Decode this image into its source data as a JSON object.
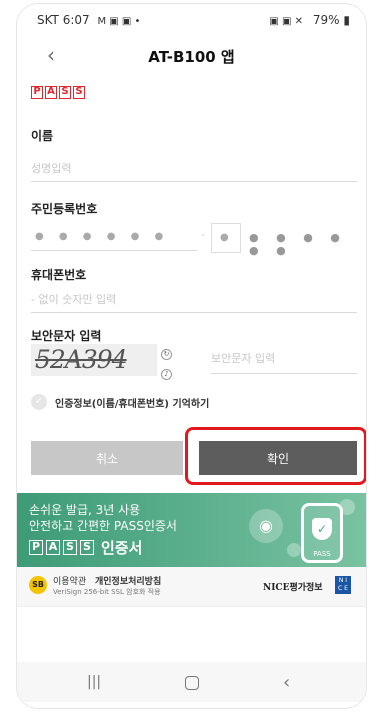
{
  "status_bar": {
    "carrier_time": "SKT 6:07",
    "notif_icons": "M ▣ ▣ •",
    "right_icons": "▣ ▣ ✕",
    "battery": "79%"
  },
  "app_bar": {
    "title": "AT-B100 앱",
    "back_icon": "back-chevron"
  },
  "pass_logo": [
    "P",
    "A",
    "S",
    "S"
  ],
  "form": {
    "name_label": "이름",
    "name_placeholder": "성명입력",
    "rrn_label": "주민등록번호",
    "rrn_front_dots": "● ● ● ● ● ●",
    "rrn_dash": "-",
    "rrn_back_dots": "● ● ● ● ● ●",
    "phone_label": "휴대폰번호",
    "phone_placeholder": "- 없이 숫자만 입력",
    "captcha_label": "보안문자 입력",
    "captcha_text": "52A394",
    "captcha_placeholder": "보안문자 입력",
    "remember_text": "인증정보(이름/휴대폰번호) 기억하기"
  },
  "buttons": {
    "cancel": "취소",
    "confirm": "확인"
  },
  "banner": {
    "line1": "손쉬운 발급, 3년 사용",
    "line2": "안전하고 간편한 PASS인증서",
    "brand_letters": [
      "P",
      "A",
      "S",
      "S"
    ],
    "brand_suffix": "인증서",
    "phone_text": "PASS"
  },
  "footer": {
    "terms": "이용약관",
    "privacy": "개인정보처리방침",
    "ssl": "VeriSign 256-bit SSL 암호화 적용",
    "nice": "NICE평가정보",
    "badge": "SB"
  },
  "colors": {
    "accent_red": "#e2282d",
    "confirm_btn": "#5d5d5d",
    "cancel_btn": "#c7c7c7",
    "banner_green": "#3d9b76"
  }
}
